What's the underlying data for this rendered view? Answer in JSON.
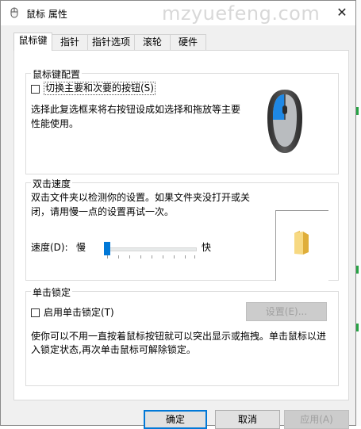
{
  "window": {
    "title": "鼠标 属性",
    "watermark": "mzyuefeng.com"
  },
  "tabs": [
    "鼠标键",
    "指针",
    "指针选项",
    "滚轮",
    "硬件"
  ],
  "button_config": {
    "group_label": "鼠标键配置",
    "swap_label": "切换主要和次要的按钮(S)",
    "swap_checked": false,
    "description_line1": "选择此复选框来将右按钮设成如选择和拖放等主要",
    "description_line2": "性能使用。"
  },
  "double_click": {
    "group_label": "双击速度",
    "description_line1": "双击文件夹以检测你的设置。如果文件夹没打开或关",
    "description_line2": "闭，请用慢一点的设置再试一次。",
    "speed_label": "速度(D):",
    "slow_label": "慢",
    "fast_label": "快",
    "speed_level": 0.05
  },
  "click_lock": {
    "group_label": "单击锁定",
    "enable_label": "启用单击锁定(T)",
    "enable_checked": false,
    "settings_button": "设置(E)...",
    "description_line1": "使你可以不用一直按着鼠标按钮就可以突出显示或拖拽。单击鼠标以进",
    "description_line2": "入锁定状态,再次单击鼠标可解除锁定。"
  },
  "footer": {
    "ok": "确定",
    "cancel": "取消",
    "apply": "应用(A)"
  },
  "colors": {
    "accent": "#0078d7",
    "folder": "#f1cf6a"
  },
  "icons": {
    "app": "mouse-icon",
    "close": "close-icon",
    "preview": "folder-icon"
  }
}
